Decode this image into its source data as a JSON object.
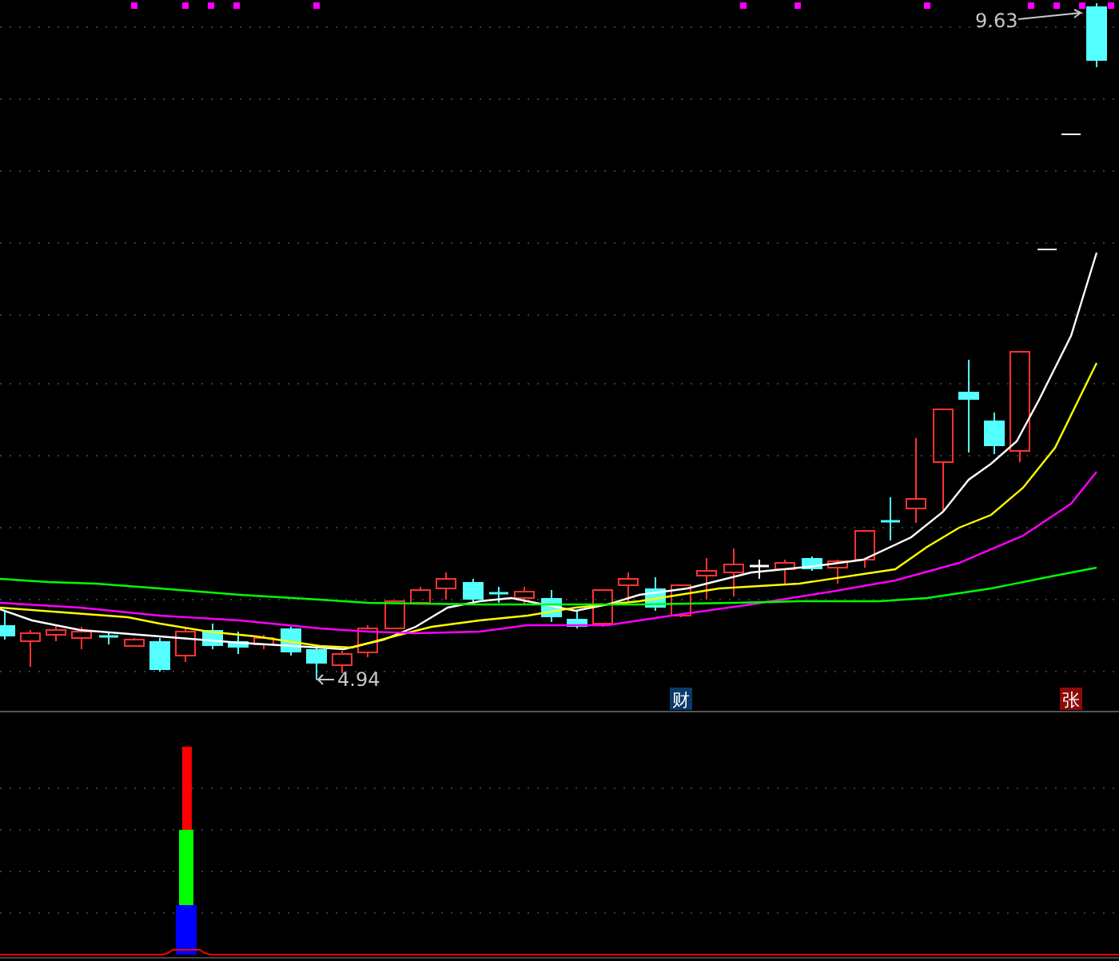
{
  "price_chart": {
    "high_label": "9.63",
    "low_label": "4.94"
  },
  "event_tags": [
    {
      "text": "财",
      "color": "#0b3a6b"
    },
    {
      "text": "张",
      "color": "#8b0a0a"
    }
  ]
}
